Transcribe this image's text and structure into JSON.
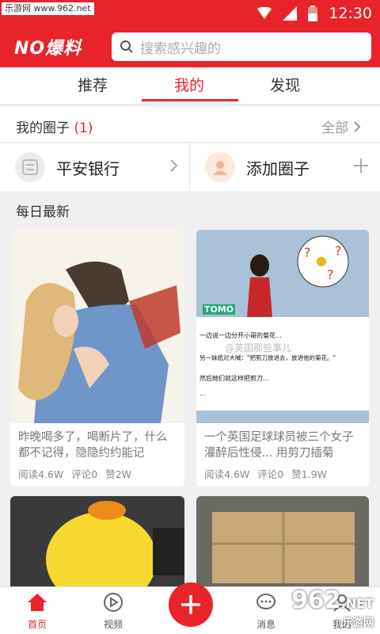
{
  "status_bar": {
    "watermark": "乐游网 www.962.net",
    "time": "12:30"
  },
  "header": {
    "logo": "NO爆料",
    "search_placeholder": "搜索感兴趣的"
  },
  "tabs": [
    {
      "label": "推荐"
    },
    {
      "label": "我的"
    },
    {
      "label": "发现"
    }
  ],
  "my_circles": {
    "title": "我的圈子",
    "count": "(1)",
    "all_label": "全部"
  },
  "circles": [
    {
      "label": "平安银行",
      "icon": "bank-logo-icon"
    },
    {
      "label": "添加圈子",
      "icon": "person-icon"
    }
  ],
  "daily": {
    "title": "每日最新"
  },
  "cards": [
    {
      "title": "昨晚喝多了，喝断片了，什么都不记得，隐隐约约能记",
      "reads": "阅读4.6W",
      "comments": "评论0",
      "likes": "赞2W"
    },
    {
      "title": "一个英国足球球员被三个女子灌醉后性侵... 用剪刀插菊",
      "reads": "阅读4.6W",
      "comments": "评论0",
      "likes": "赞1.9W",
      "image_texts": [
        "TOMO",
        "一边说一边分开小哥的菊花...",
        "另一妹纸对大喊：\"把剪刀放进去，放进他的菊花。\"",
        "然后她们就这样把剪刀...",
        "...",
        "@英国那些事儿"
      ]
    }
  ],
  "bottom_nav": [
    {
      "label": "首页"
    },
    {
      "label": "视频"
    },
    {
      "label": "消息"
    },
    {
      "label": "我的"
    }
  ],
  "corner_watermark": {
    "number": "962",
    "suffix": ".NET",
    "text": "乐游网"
  },
  "colors": {
    "brand": "#e8232a"
  }
}
